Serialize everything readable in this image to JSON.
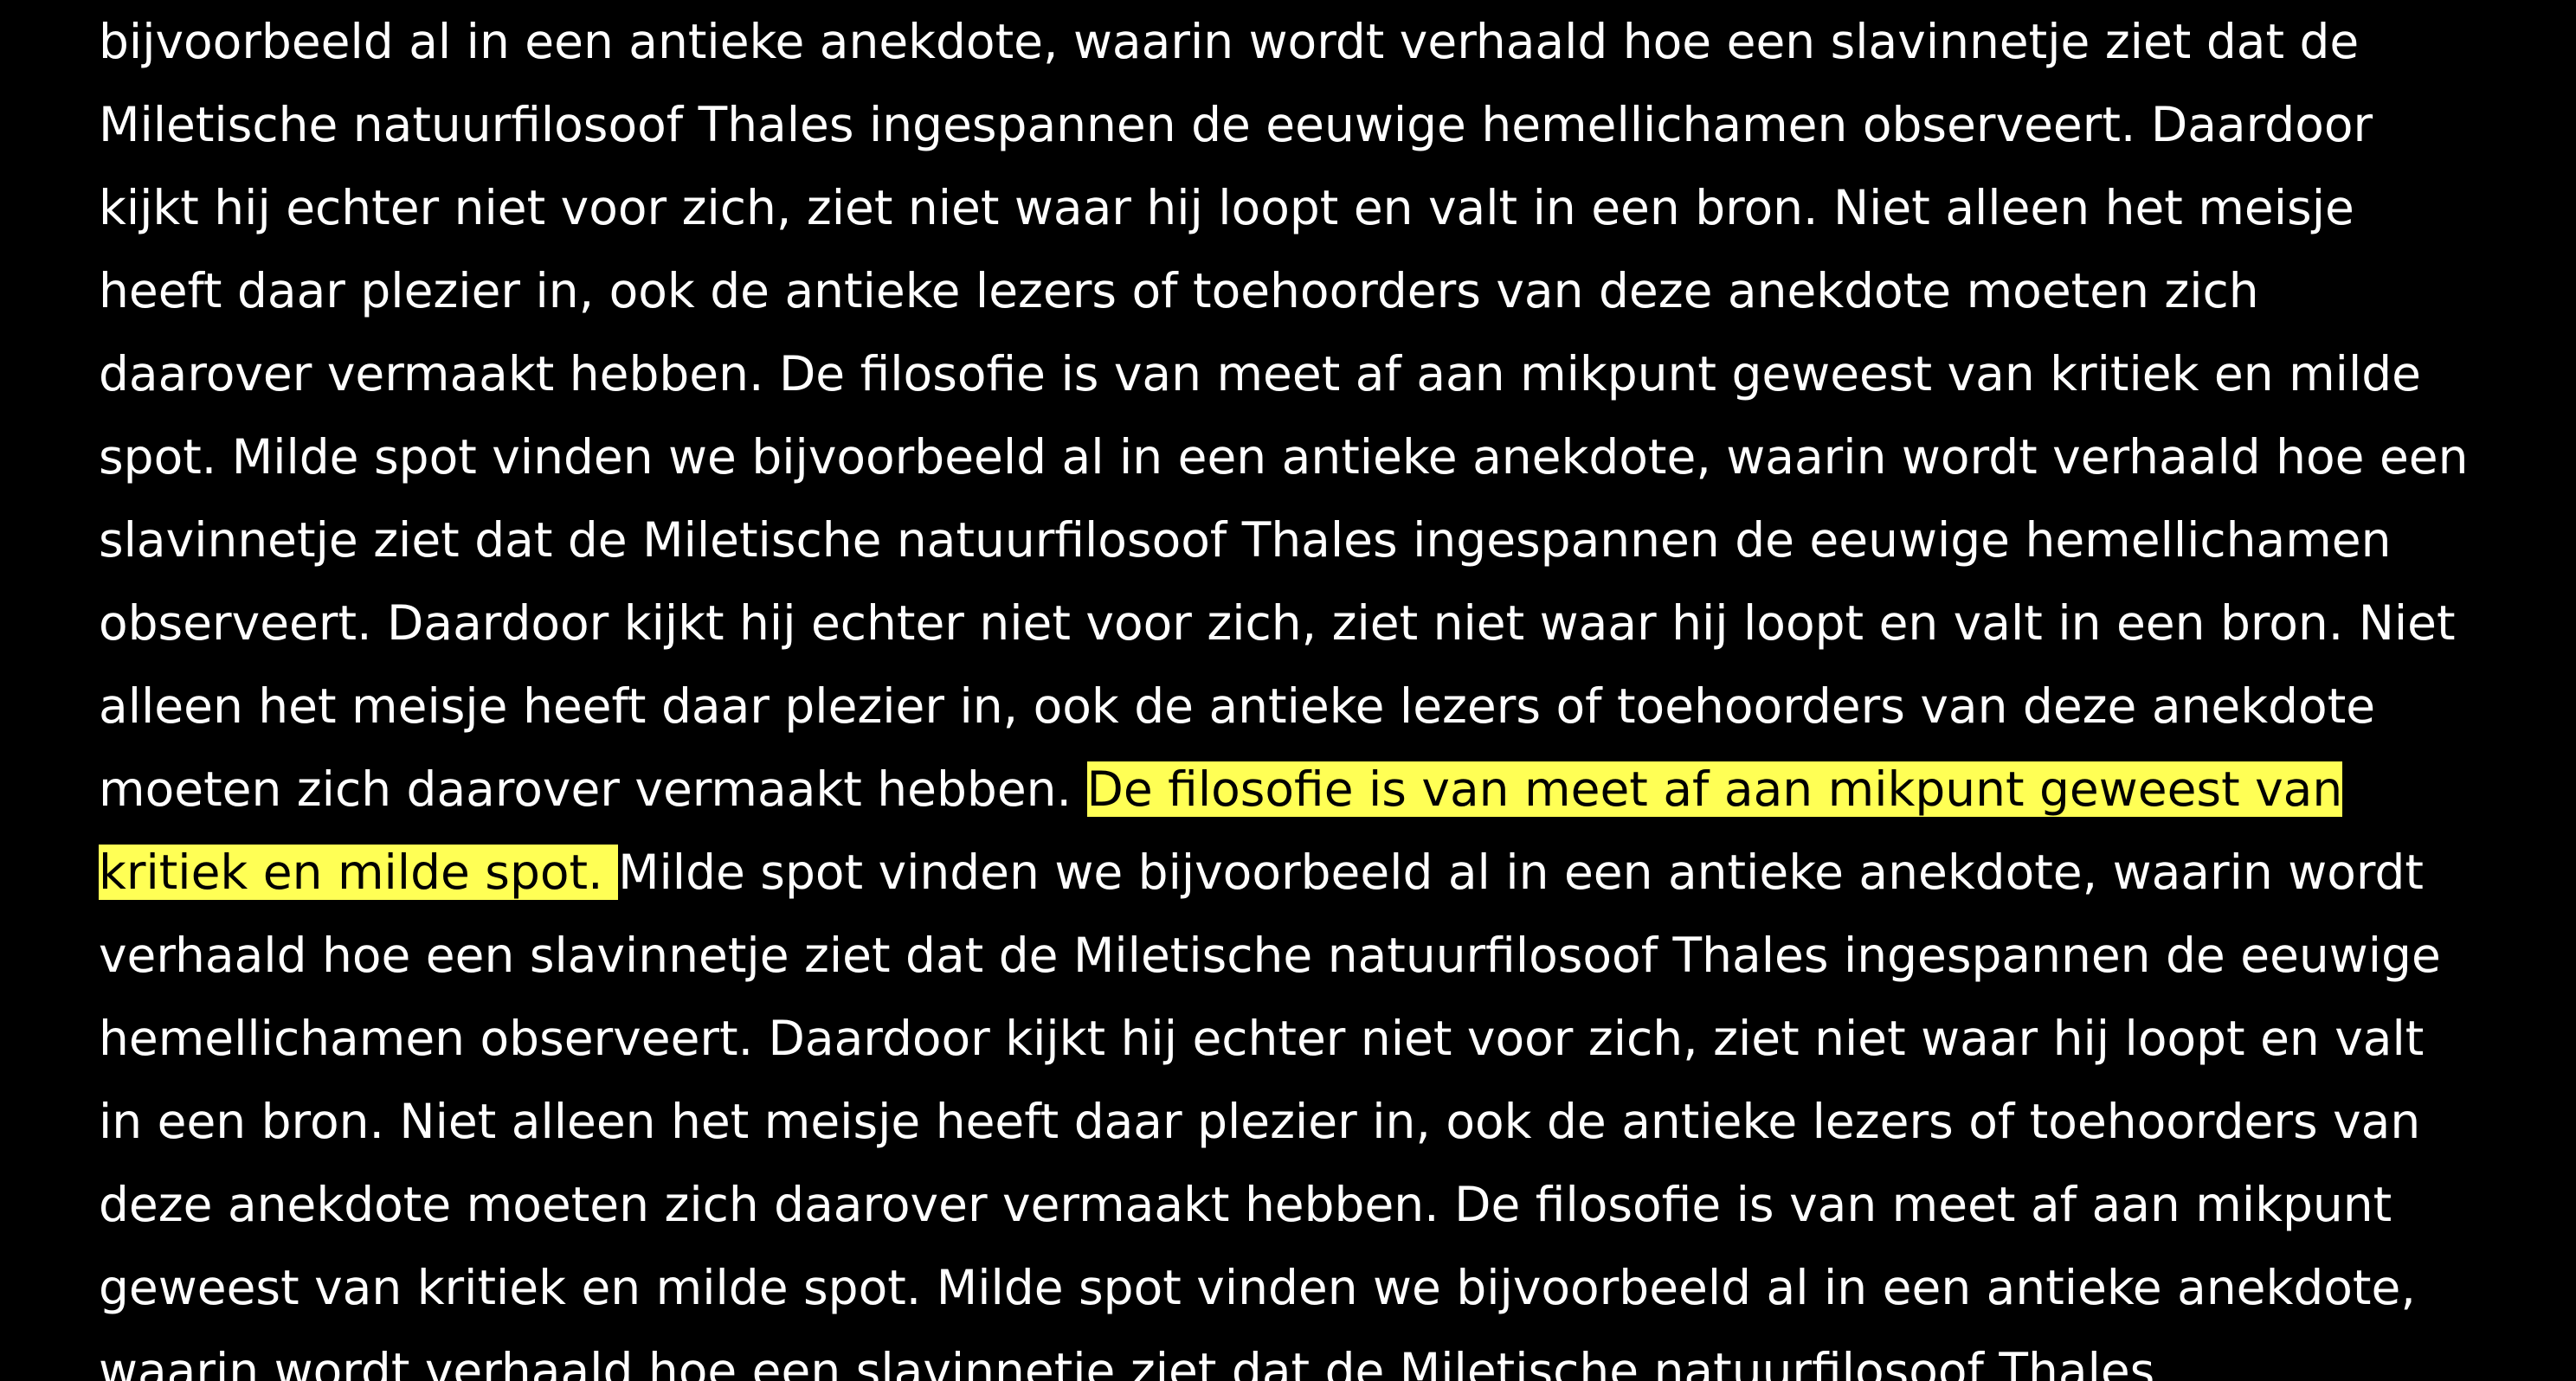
{
  "document": {
    "colors": {
      "background": "#000000",
      "text": "#ffffff",
      "highlight_background": "#ffff55",
      "highlight_text": "#000000"
    },
    "lines": [
      {
        "segments": [
          {
            "text": "bijvoorbeeld al in een antieke anekdote, waarin wordt verhaald hoe een slavinnetje ziet dat de",
            "highlight": false
          }
        ]
      },
      {
        "segments": [
          {
            "text": "Miletische natuurfilosoof Thales ingespannen de eeuwige hemellichamen observeert. Daardoor",
            "highlight": false
          }
        ]
      },
      {
        "segments": [
          {
            "text": "kijkt hij echter niet voor zich, ziet niet waar hij loopt en valt in een bron. Niet alleen het meisje",
            "highlight": false
          }
        ]
      },
      {
        "segments": [
          {
            "text": "heeft daar plezier in, ook de antieke lezers of toehoorders van deze anekdote moeten zich",
            "highlight": false
          }
        ]
      },
      {
        "segments": [
          {
            "text": "daarover vermaakt hebben. De filosofie is van meet af aan mikpunt geweest van kritiek en milde",
            "highlight": false
          }
        ]
      },
      {
        "segments": [
          {
            "text": "spot. Milde spot vinden we bijvoorbeeld al in een antieke anekdote, waarin wordt verhaald hoe een",
            "highlight": false
          }
        ]
      },
      {
        "segments": [
          {
            "text": "slavinnetje ziet dat de Miletische natuurfilosoof Thales ingespannen de eeuwige hemellichamen",
            "highlight": false
          }
        ]
      },
      {
        "segments": [
          {
            "text": "observeert. Daardoor kijkt hij echter niet voor zich, ziet niet waar hij loopt en valt in een bron. Niet",
            "highlight": false
          }
        ]
      },
      {
        "segments": [
          {
            "text": "alleen het meisje heeft daar plezier in, ook de antieke lezers of toehoorders van deze anekdote",
            "highlight": false
          }
        ]
      },
      {
        "segments": [
          {
            "text": "moeten zich daarover vermaakt hebben. ",
            "highlight": false
          },
          {
            "text": "De filosofie is van meet af aan mikpunt geweest van",
            "highlight": true
          }
        ]
      },
      {
        "segments": [
          {
            "text": "kritiek en milde spot. ",
            "highlight": true
          },
          {
            "text": "Milde spot vinden we bijvoorbeeld al in een antieke anekdote, waarin wordt",
            "highlight": false
          }
        ]
      },
      {
        "segments": [
          {
            "text": "verhaald hoe een slavinnetje ziet dat de Miletische natuurfilosoof Thales ingespannen de eeuwige",
            "highlight": false
          }
        ]
      },
      {
        "segments": [
          {
            "text": "hemellichamen observeert. Daardoor kijkt hij echter niet voor zich, ziet niet waar hij loopt en valt",
            "highlight": false
          }
        ]
      },
      {
        "segments": [
          {
            "text": "in een bron. Niet alleen het meisje heeft daar plezier in, ook de antieke lezers of toehoorders van",
            "highlight": false
          }
        ]
      },
      {
        "segments": [
          {
            "text": "deze anekdote moeten zich daarover vermaakt hebben. De filosofie is van meet af aan mikpunt",
            "highlight": false
          }
        ]
      },
      {
        "segments": [
          {
            "text": "geweest van kritiek en milde spot. Milde spot vinden we bijvoorbeeld al in een antieke anekdote,",
            "highlight": false
          }
        ]
      },
      {
        "segments": [
          {
            "text": "waarin wordt verhaald hoe een slavinnetje ziet dat de Miletische natuurfilosoof Thales",
            "highlight": false
          }
        ]
      }
    ]
  }
}
